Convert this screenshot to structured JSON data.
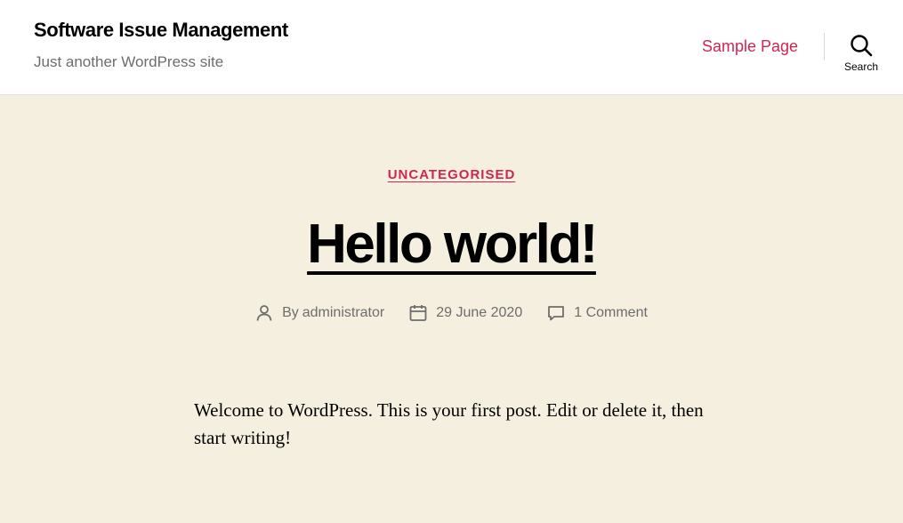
{
  "header": {
    "site_title": "Software Issue Management",
    "site_description": "Just another WordPress site",
    "nav": [
      {
        "label": "Sample Page"
      }
    ],
    "search_label": "Search"
  },
  "post": {
    "category": "UNCATEGORISED",
    "title": "Hello world!",
    "meta": {
      "by_prefix": "By",
      "author": "administrator",
      "date": "29 June 2020",
      "comments": "1 Comment"
    },
    "content": "Welcome to WordPress. This is your first post. Edit or delete it, then start writing!"
  },
  "colors": {
    "accent": "#cd2653",
    "background": "#f5efe0",
    "header_background": "#ffffff",
    "meta_text": "#6d6d6d"
  },
  "icons": [
    "search-icon",
    "person-icon",
    "calendar-icon",
    "comment-icon"
  ]
}
